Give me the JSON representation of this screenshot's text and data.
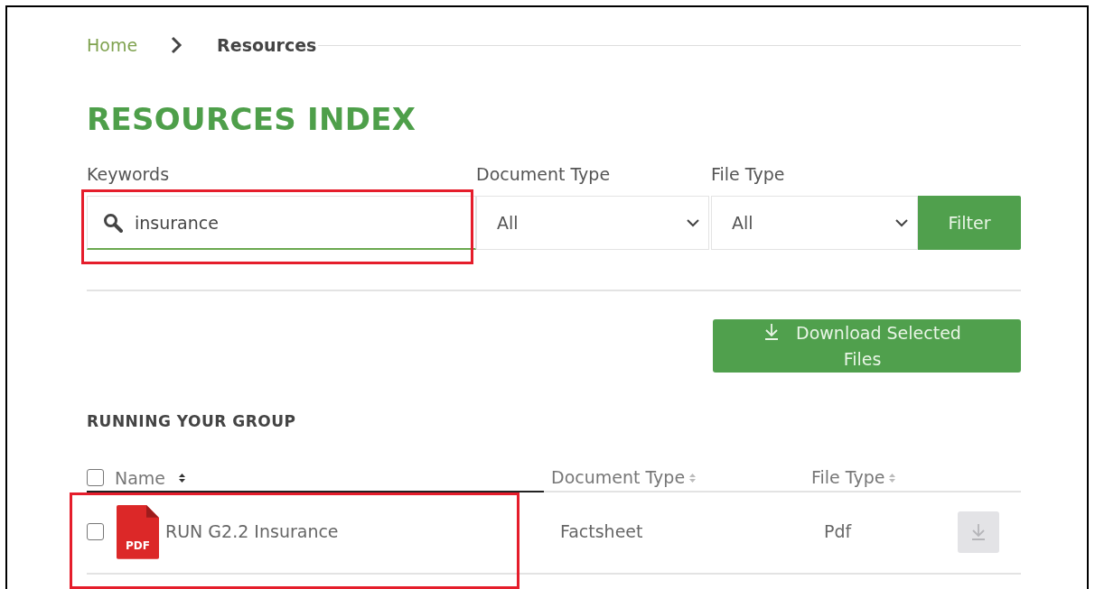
{
  "breadcrumb": [
    {
      "label": "Home",
      "current": false
    },
    {
      "label": "Resources",
      "current": true
    }
  ],
  "title": "RESOURCES INDEX",
  "filters": {
    "keywords": {
      "label": "Keywords",
      "value": "insurance"
    },
    "document_type": {
      "label": "Document Type",
      "value": "All"
    },
    "file_type": {
      "label": "File Type",
      "value": "All"
    },
    "button": "Filter"
  },
  "download_selected": "Download Selected Files",
  "section": {
    "title": "RUNNING YOUR GROUP",
    "columns": [
      {
        "label": "Name",
        "sort_active": true
      },
      {
        "label": "Document Type",
        "sort_active": false
      },
      {
        "label": "File Type",
        "sort_active": false
      }
    ],
    "select_all": {
      "checked": false
    },
    "rows": [
      {
        "checked": false,
        "file_icon_label": "PDF",
        "name": "RUN G2.2 Insurance",
        "document_type": "Factsheet",
        "file_type": "Pdf",
        "download_disabled": true
      }
    ]
  }
}
